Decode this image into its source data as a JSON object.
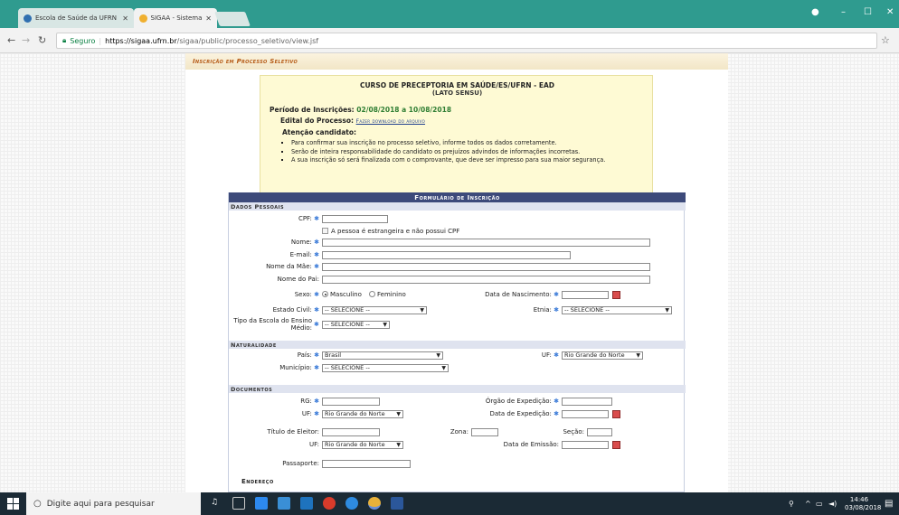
{
  "browser": {
    "tabs": [
      {
        "title": "Escola de Saúde da UFRN"
      },
      {
        "title": "SIGAA - Sistema Integrad"
      }
    ],
    "secure_label": "Seguro",
    "url_host": "https://sigaa.ufrn.br",
    "url_path": "/sigaa/public/processo_seletivo/view.jsf"
  },
  "page": {
    "title": "Inscrição em Processo Seletivo",
    "course_title": "CURSO DE PRECEPTORIA EM SAÚDE/ES/UFRN - EAD",
    "course_subtitle": "(LATO SENSU)",
    "period_label": "Período de Inscrições:",
    "period_value": "02/08/2018 a 10/08/2018",
    "edital_label": "Edital do Processo:",
    "edital_link": "Fazer download do arquivo",
    "attention_label": "Atenção candidato:",
    "notes": [
      "Para confirmar sua inscrição no processo seletivo, informe todos os dados corretamente.",
      "Serão de inteira responsabilidade do candidato os prejuízos advindos de informações incorretas.",
      "A sua inscrição só será finalizada com o comprovante, que deve ser impresso para sua maior segurança."
    ]
  },
  "form": {
    "header": "Formulário de Inscrição",
    "sections": {
      "personal": "Dados Pessoais",
      "birthplace": "Naturalidade",
      "documents": "Documentos",
      "address": "Endereço"
    },
    "labels": {
      "cpf": "CPF:",
      "foreigner": "A pessoa é estrangeira e não possui CPF",
      "name": "Nome:",
      "email": "E-mail:",
      "mother": "Nome da Mãe:",
      "father": "Nome do Pai:",
      "sex": "Sexo:",
      "male": "Masculino",
      "female": "Feminino",
      "birth_date": "Data de Nascimento:",
      "civil_status": "Estado Civil:",
      "ethnicity": "Etnia:",
      "school_type_1": "Tipo da Escola do Ensino",
      "school_type_2": "Médio:",
      "country": "País:",
      "uf": "UF:",
      "city": "Município:",
      "rg": "RG:",
      "issuer": "Órgão de Expedição:",
      "doc_uf": "UF:",
      "issue_date": "Data de Expedição:",
      "voter_id": "Título de Eleitor:",
      "zone": "Zona:",
      "section": "Seção:",
      "voter_uf": "UF:",
      "emission_date": "Data de Emissão:",
      "passport": "Passaporte:"
    },
    "values": {
      "sex_selected": "Masculino",
      "civil_status": "-- SELECIONE --",
      "ethnicity": "-- SELECIONE --",
      "school_type": "-- SELECIONE --",
      "country": "Brasil",
      "uf": "Rio Grande do Norte",
      "city": "-- SELECIONE --",
      "doc_uf": "Rio Grande do Norte",
      "voter_uf": "Rio Grande do Norte"
    }
  },
  "taskbar": {
    "search_placeholder": "Digite aqui para pesquisar",
    "time": "14:46",
    "date": "03/08/2018"
  },
  "colors": {
    "titlebar": "#2f9b8f",
    "form_header": "#3d4a7a",
    "section_bg": "#dfe3ef",
    "info_bg": "#fefad4",
    "required": "#3b7bd8"
  }
}
